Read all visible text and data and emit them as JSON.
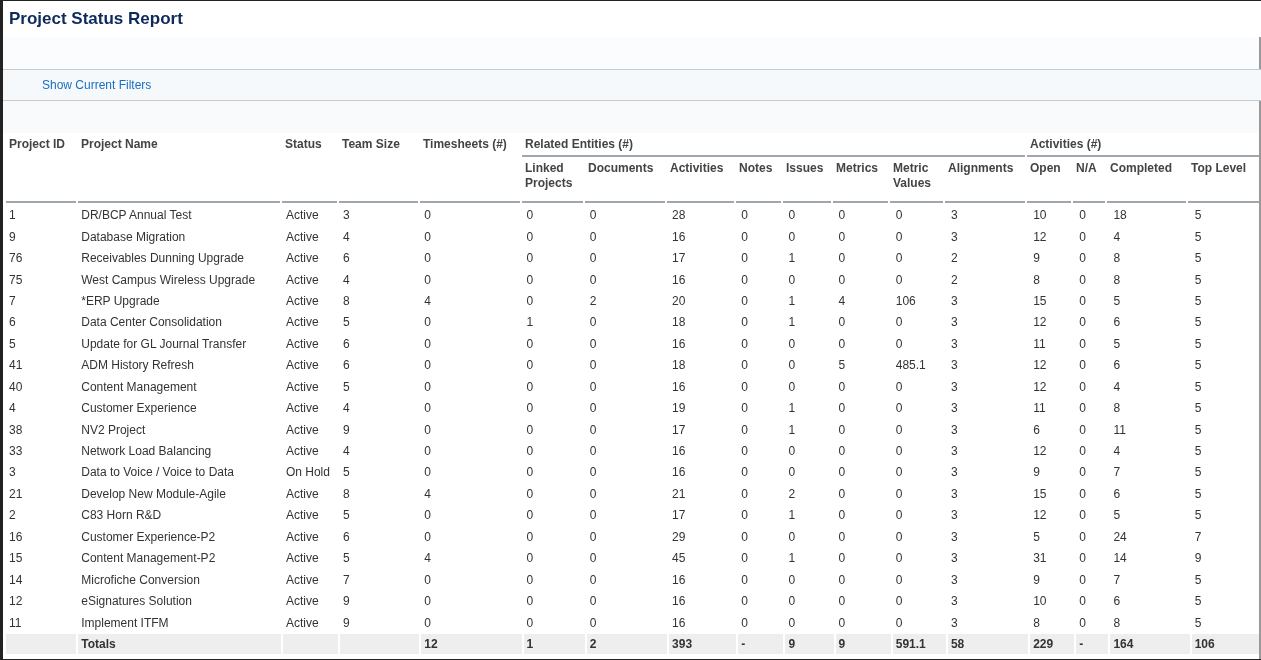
{
  "title": "Project Status Report",
  "filters_link": "Show Current Filters",
  "table": {
    "columns": [
      {
        "kind": "single",
        "label": "Project ID"
      },
      {
        "kind": "single",
        "label": "Project Name"
      },
      {
        "kind": "single",
        "label": "Status"
      },
      {
        "kind": "single",
        "label": "Team Size"
      },
      {
        "kind": "single",
        "label": "Timesheets (#)"
      },
      {
        "kind": "grouped",
        "group": "Related Entities (#)",
        "label": "Linked Projects"
      },
      {
        "kind": "grouped",
        "label": "Documents"
      },
      {
        "kind": "grouped",
        "label": "Activities"
      },
      {
        "kind": "grouped",
        "label": "Notes"
      },
      {
        "kind": "grouped",
        "label": "Issues"
      },
      {
        "kind": "grouped",
        "label": "Metrics"
      },
      {
        "kind": "grouped",
        "label": "Metric Values"
      },
      {
        "kind": "grouped",
        "label": "Alignments"
      },
      {
        "kind": "grouped",
        "group": "Activities (#)",
        "label": "Open"
      },
      {
        "kind": "grouped",
        "label": "N/A"
      },
      {
        "kind": "grouped",
        "label": "Completed"
      },
      {
        "kind": "grouped",
        "label": "Top Level"
      }
    ],
    "rows": [
      [
        "1",
        "DR/BCP Annual Test",
        "Active",
        "3",
        "0",
        "0",
        "0",
        "28",
        "0",
        "0",
        "0",
        "0",
        "3",
        "10",
        "0",
        "18",
        "5"
      ],
      [
        "9",
        "Database Migration",
        "Active",
        "4",
        "0",
        "0",
        "0",
        "16",
        "0",
        "0",
        "0",
        "0",
        "3",
        "12",
        "0",
        "4",
        "5"
      ],
      [
        "76",
        "Receivables Dunning Upgrade",
        "Active",
        "6",
        "0",
        "0",
        "0",
        "17",
        "0",
        "1",
        "0",
        "0",
        "2",
        "9",
        "0",
        "8",
        "5"
      ],
      [
        "75",
        "West Campus Wireless Upgrade",
        "Active",
        "4",
        "0",
        "0",
        "0",
        "16",
        "0",
        "0",
        "0",
        "0",
        "2",
        "8",
        "0",
        "8",
        "5"
      ],
      [
        "7",
        "*ERP Upgrade",
        "Active",
        "8",
        "4",
        "0",
        "2",
        "20",
        "0",
        "1",
        "4",
        "106",
        "3",
        "15",
        "0",
        "5",
        "5"
      ],
      [
        "6",
        "Data Center Consolidation",
        "Active",
        "5",
        "0",
        "1",
        "0",
        "18",
        "0",
        "1",
        "0",
        "0",
        "3",
        "12",
        "0",
        "6",
        "5"
      ],
      [
        "5",
        "Update for GL Journal Transfer",
        "Active",
        "6",
        "0",
        "0",
        "0",
        "16",
        "0",
        "0",
        "0",
        "0",
        "3",
        "11",
        "0",
        "5",
        "5"
      ],
      [
        "41",
        "ADM History Refresh",
        "Active",
        "6",
        "0",
        "0",
        "0",
        "18",
        "0",
        "0",
        "5",
        "485.1",
        "3",
        "12",
        "0",
        "6",
        "5"
      ],
      [
        "40",
        "Content Management",
        "Active",
        "5",
        "0",
        "0",
        "0",
        "16",
        "0",
        "0",
        "0",
        "0",
        "3",
        "12",
        "0",
        "4",
        "5"
      ],
      [
        "4",
        "Customer Experience",
        "Active",
        "4",
        "0",
        "0",
        "0",
        "19",
        "0",
        "1",
        "0",
        "0",
        "3",
        "11",
        "0",
        "8",
        "5"
      ],
      [
        "38",
        "NV2 Project",
        "Active",
        "9",
        "0",
        "0",
        "0",
        "17",
        "0",
        "1",
        "0",
        "0",
        "3",
        "6",
        "0",
        "11",
        "5"
      ],
      [
        "33",
        "Network Load Balancing",
        "Active",
        "4",
        "0",
        "0",
        "0",
        "16",
        "0",
        "0",
        "0",
        "0",
        "3",
        "12",
        "0",
        "4",
        "5"
      ],
      [
        "3",
        "Data to Voice / Voice to Data",
        "On Hold",
        "5",
        "0",
        "0",
        "0",
        "16",
        "0",
        "0",
        "0",
        "0",
        "3",
        "9",
        "0",
        "7",
        "5"
      ],
      [
        "21",
        "Develop New Module-Agile",
        "Active",
        "8",
        "4",
        "0",
        "0",
        "21",
        "0",
        "2",
        "0",
        "0",
        "3",
        "15",
        "0",
        "6",
        "5"
      ],
      [
        "2",
        "C83 Horn R&D",
        "Active",
        "5",
        "0",
        "0",
        "0",
        "17",
        "0",
        "1",
        "0",
        "0",
        "3",
        "12",
        "0",
        "5",
        "5"
      ],
      [
        "16",
        "Customer Experience-P2",
        "Active",
        "6",
        "0",
        "0",
        "0",
        "29",
        "0",
        "0",
        "0",
        "0",
        "3",
        "5",
        "0",
        "24",
        "7"
      ],
      [
        "15",
        "Content Management-P2",
        "Active",
        "5",
        "4",
        "0",
        "0",
        "45",
        "0",
        "1",
        "0",
        "0",
        "3",
        "31",
        "0",
        "14",
        "9"
      ],
      [
        "14",
        "Microfiche Conversion",
        "Active",
        "7",
        "0",
        "0",
        "0",
        "16",
        "0",
        "0",
        "0",
        "0",
        "3",
        "9",
        "0",
        "7",
        "5"
      ],
      [
        "12",
        "eSignatures Solution",
        "Active",
        "9",
        "0",
        "0",
        "0",
        "16",
        "0",
        "0",
        "0",
        "0",
        "3",
        "10",
        "0",
        "6",
        "5"
      ],
      [
        "11",
        "Implement ITFM",
        "Active",
        "9",
        "0",
        "0",
        "0",
        "16",
        "0",
        "0",
        "0",
        "0",
        "3",
        "8",
        "0",
        "8",
        "5"
      ]
    ],
    "totals": {
      "label": "Totals",
      "values": [
        "12",
        "1",
        "2",
        "393",
        "-",
        "9",
        "9",
        "591.1",
        "58",
        "229",
        "-",
        "164",
        "106"
      ]
    }
  }
}
